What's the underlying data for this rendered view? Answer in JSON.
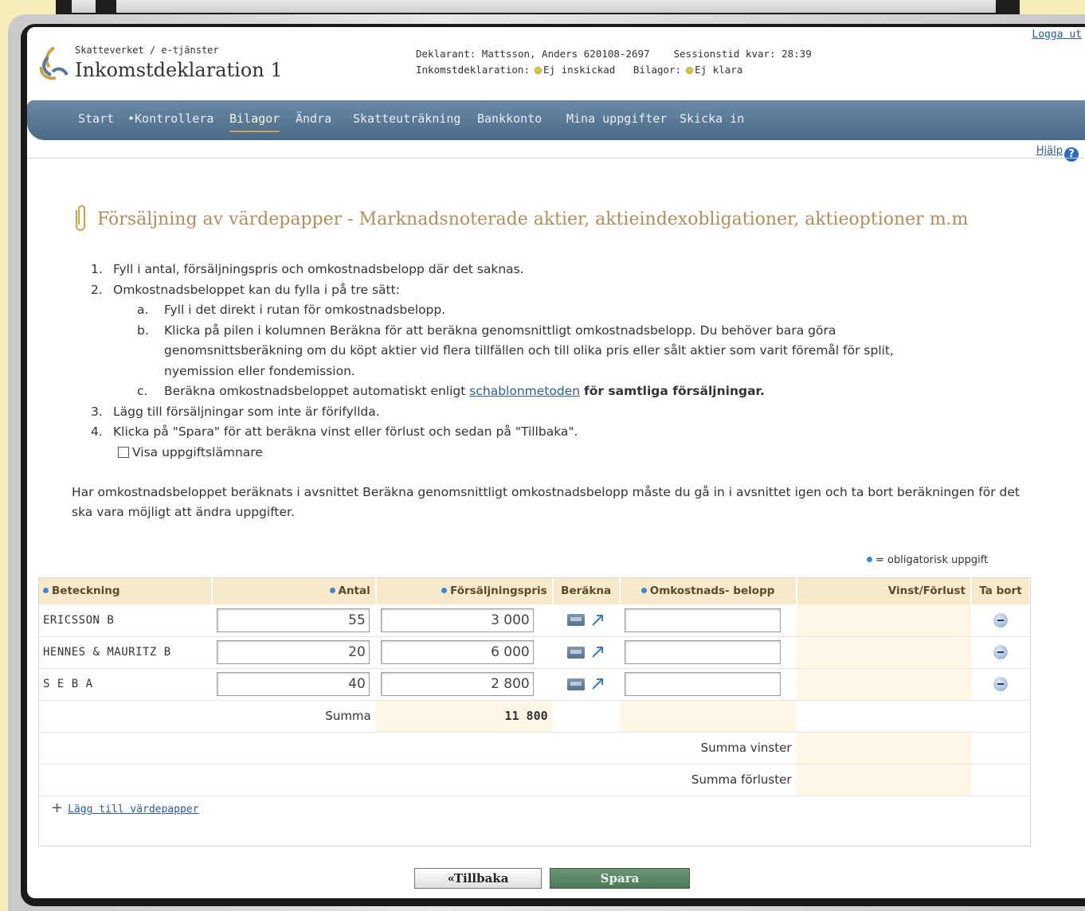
{
  "header": {
    "brand_small": "Skatteverket / e-tjänster",
    "brand_title": "Inkomstdeklaration 1",
    "declarant_label": "Deklarant:",
    "declarant_value": "Mattsson, Anders 620108-2697",
    "session_label": "Sessionstid kvar:",
    "session_value": "28:39",
    "status_label": "Inkomstdeklaration:",
    "status_value": "Ej inskickad",
    "attachments_label": "Bilagor:",
    "attachments_value": "Ej klara",
    "logout": "Logga ut"
  },
  "nav": {
    "items": [
      {
        "label": "Start"
      },
      {
        "label": "•Kontrollera"
      },
      {
        "label": "Bilagor"
      },
      {
        "label": "Ändra"
      },
      {
        "label": "Skatteuträkning"
      },
      {
        "label": "Bankkonto"
      },
      {
        "label": "Mina uppgifter"
      },
      {
        "label": "Skicka in"
      }
    ],
    "active": "Bilagor"
  },
  "help": "Hjälp",
  "page_title": "Försäljning av värdepapper - Marknadsnoterade aktier, aktieindexobligationer, aktieoptioner m.m",
  "instructions": {
    "n1": "1.",
    "i1": "Fyll i antal, försäljningspris och omkostnadsbelopp där det saknas.",
    "n2": "2.",
    "i2": "Omkostnadsbeloppet kan du fylla i på tre sätt:",
    "a_letter": "a.",
    "a": "Fyll i det direkt i rutan för omkostnadsbelopp.",
    "b_letter": "b.",
    "b1": "Klicka på pilen i kolumnen Beräkna för att beräkna genomsnittligt omkostnadsbelopp. Du behöver bara göra",
    "b2": "genomsnittsberäkning om du köpt aktier vid flera tillfällen och till olika pris eller sålt aktier som varit föremål för split,",
    "b3": "nyemission eller fondemission.",
    "c_letter": "c.",
    "c_pre": "Beräkna omkostnadsbeloppet automatiskt enligt",
    "c_link": "schablonmetoden",
    "c_bold": "för samtliga försäljningar.",
    "n3": "3.",
    "i3": "Lägg till försäljningar som inte är förifyllda.",
    "n4": "4.",
    "i4": "Klicka på \"Spara\" för att beräkna vinst eller förlust och sedan på \"Tillbaka\".",
    "checkbox_label": "Visa uppgiftslämnare"
  },
  "paragraph": "Har omkostnadsbeloppet beräknats i avsnittet Beräkna genomsnittligt omkostnadsbelopp måste du gå in i avsnittet igen och ta bort beräkningen för det ska vara möjligt att ändra uppgifter.",
  "legend": "= obligatorisk uppgift",
  "table": {
    "headers": {
      "beteckning": "Beteckning",
      "antal": "Antal",
      "pris": "Försäljningspris",
      "berakna": "Beräkna",
      "omk": "Omkostnads- belopp",
      "vinst": "Vinst/Förlust",
      "tabort": "Ta bort"
    },
    "rows": [
      {
        "name": "ERICSSON B",
        "antal": "55",
        "pris": "3 000",
        "omk": ""
      },
      {
        "name": "HENNES & MAURITZ B",
        "antal": "20",
        "pris": "6 000",
        "omk": ""
      },
      {
        "name": "S E B A",
        "antal": "40",
        "pris": "2 800",
        "omk": ""
      }
    ],
    "summa_label": "Summa",
    "summa_value": "11 800",
    "summa_vinster": "Summa vinster",
    "summa_forluster": "Summa förluster"
  },
  "add_link": "Lägg till värdepapper",
  "buttons": {
    "back": "«Tillbaka",
    "save": "Spara"
  },
  "colors": {
    "nav": "#5a7997",
    "accent": "#b08d5d",
    "save": "#5a8766",
    "header_bg": "#f8eac9"
  }
}
